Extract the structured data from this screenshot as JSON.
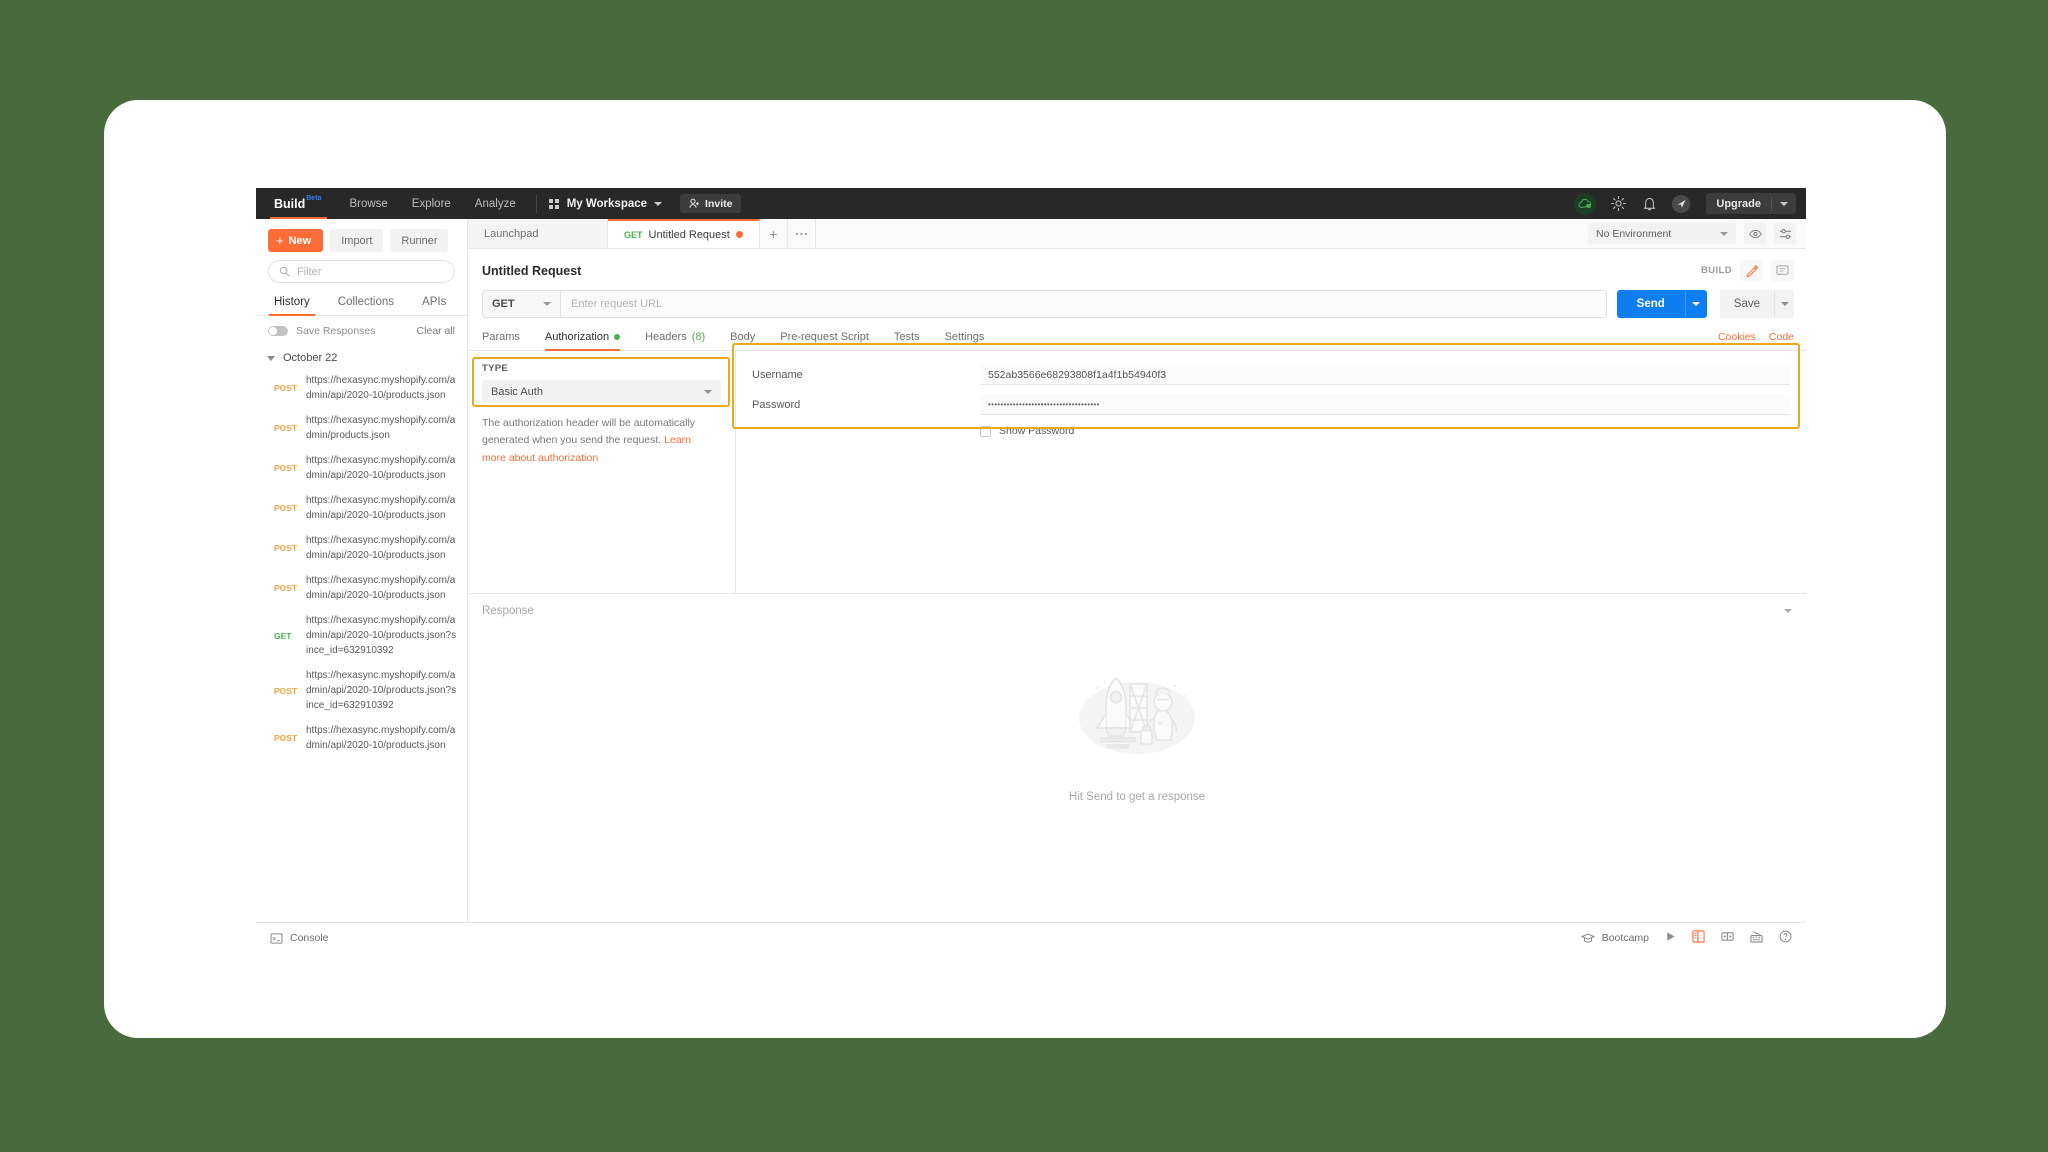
{
  "navbar": {
    "build_label": "Build",
    "build_badge": "Beta",
    "items": [
      "Browse",
      "Explore",
      "Analyze"
    ],
    "workspace": "My Workspace",
    "invite_label": "Invite",
    "upgrade_label": "Upgrade",
    "icons": [
      "cloud-sync-icon",
      "gear-icon",
      "bell-icon",
      "avatar",
      "caret-down-icon"
    ]
  },
  "sidebar": {
    "new_label": "New",
    "import_label": "Import",
    "runner_label": "Runner",
    "filter_placeholder": "Filter",
    "tabs": [
      {
        "label": "History",
        "active": true
      },
      {
        "label": "Collections",
        "active": false
      },
      {
        "label": "APIs",
        "active": false
      }
    ],
    "save_responses_label": "Save Responses",
    "clear_all_label": "Clear all",
    "date_group": "October 22",
    "history": [
      {
        "method": "POST",
        "url": "https://hexasync.myshopify.com/admin/api/2020-10/products.json"
      },
      {
        "method": "POST",
        "url": "https://hexasync.myshopify.com/admin/products.json"
      },
      {
        "method": "POST",
        "url": "https://hexasync.myshopify.com/admin/api/2020-10/products.json"
      },
      {
        "method": "POST",
        "url": "https://hexasync.myshopify.com/admin/api/2020-10/products.json"
      },
      {
        "method": "POST",
        "url": "https://hexasync.myshopify.com/admin/api/2020-10/products.json"
      },
      {
        "method": "POST",
        "url": "https://hexasync.myshopify.com/admin/api/2020-10/products.json"
      },
      {
        "method": "GET",
        "url": "https://hexasync.myshopify.com/admin/api/2020-10/products.json?since_id=632910392"
      },
      {
        "method": "POST",
        "url": "https://hexasync.myshopify.com/admin/api/2020-10/products.json?since_id=632910392"
      },
      {
        "method": "POST",
        "url": "https://hexasync.myshopify.com/admin/api/2020-10/products.json"
      }
    ]
  },
  "tabbar": {
    "tabs": [
      {
        "label": "Launchpad",
        "method": "",
        "active": false,
        "dirty": false
      },
      {
        "label": "Untitled Request",
        "method": "GET",
        "active": true,
        "dirty": true
      }
    ],
    "environment": "No Environment"
  },
  "request": {
    "title": "Untitled Request",
    "build_label": "BUILD",
    "method": "GET",
    "url_placeholder": "Enter request URL",
    "send_label": "Send",
    "save_label": "Save",
    "subtabs": [
      {
        "label": "Params",
        "active": false
      },
      {
        "label": "Authorization",
        "active": true,
        "dot": true
      },
      {
        "label": "Headers",
        "active": false,
        "count": "(8)"
      },
      {
        "label": "Body",
        "active": false
      },
      {
        "label": "Pre-request Script",
        "active": false
      },
      {
        "label": "Tests",
        "active": false
      },
      {
        "label": "Settings",
        "active": false
      }
    ],
    "cookies_label": "Cookies",
    "code_label": "Code"
  },
  "authorization": {
    "type_label": "TYPE",
    "type_value": "Basic Auth",
    "help_text": "The authorization header will be automatically generated when you send the request.",
    "help_link": "Learn more about authorization",
    "username_label": "Username",
    "username_value": "552ab3566e68293808f1a4f1b54940f3",
    "password_label": "Password",
    "password_value": "••••••••••••••••••••••••••••••••••••",
    "show_password_label": "Show Password",
    "highlight_color": "#e9a820"
  },
  "response": {
    "label": "Response",
    "empty_message": "Hit Send to get a response"
  },
  "statusbar": {
    "console_label": "Console",
    "bootcamp_label": "Bootcamp",
    "icons": [
      "console-icon",
      "graduation-cap-icon",
      "run-icon",
      "two-pane-layout-icon",
      "side-by-side-layout-icon",
      "keyboard-shortcuts-icon",
      "help-icon"
    ]
  },
  "theme": {
    "page_background": "#476b3d",
    "accent": "#ff6c37",
    "send_blue": "#0f7ef1",
    "navbar_dark": "#282829"
  }
}
